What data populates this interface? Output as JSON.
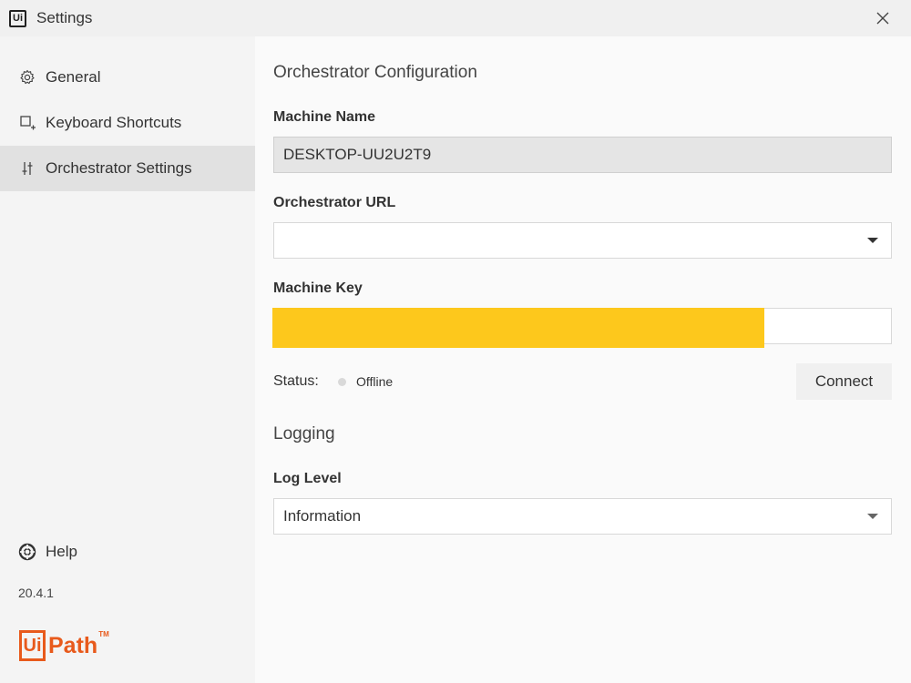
{
  "window": {
    "title": "Settings",
    "app_icon_text": "Ui"
  },
  "sidebar": {
    "items": [
      {
        "label": "General",
        "icon": "gear-icon"
      },
      {
        "label": "Keyboard Shortcuts",
        "icon": "keyboard-shortcut-icon"
      },
      {
        "label": "Orchestrator Settings",
        "icon": "sliders-icon",
        "active": true
      }
    ],
    "help_label": "Help",
    "version": "20.4.1",
    "brand": {
      "box": "Ui",
      "text": "Path",
      "tm": "TM"
    }
  },
  "main": {
    "orchestrator_title": "Orchestrator Configuration",
    "machine_name_label": "Machine Name",
    "machine_name_value": "DESKTOP-UU2U2T9",
    "orchestrator_url_label": "Orchestrator URL",
    "orchestrator_url_value": "",
    "machine_key_label": "Machine Key",
    "status_label": "Status:",
    "status_value": "Offline",
    "connect_label": "Connect",
    "logging_title": "Logging",
    "log_level_label": "Log Level",
    "log_level_value": "Information"
  },
  "colors": {
    "brand": "#e85a1c",
    "redaction": "#fdc81c",
    "active_nav": "#e1e1e1"
  }
}
